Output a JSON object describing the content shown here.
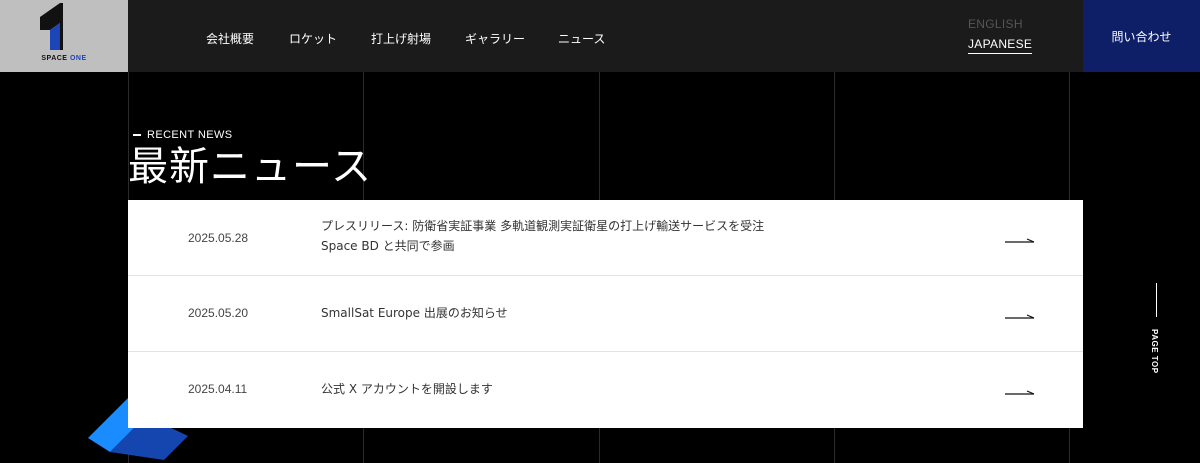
{
  "header": {
    "logo_text_a": "SPACE",
    "logo_text_b": "ONE",
    "nav": [
      {
        "label": "会社概要"
      },
      {
        "label": "ロケット"
      },
      {
        "label": "打上げ射場"
      },
      {
        "label": "ギャラリー"
      },
      {
        "label": "ニュース"
      }
    ],
    "lang_en": "ENGLISH",
    "lang_ja": "JAPANESE",
    "contact_label": "問い合わせ"
  },
  "section": {
    "subtitle": "RECENT NEWS",
    "title": "最新ニュース"
  },
  "news": [
    {
      "date": "2025.05.28",
      "title_line1": "プレスリリース: 防衛省実証事業 多軌道観測実証衛星の打上げ輸送サービスを受注",
      "title_line2": "Space BD と共同で参画"
    },
    {
      "date": "2025.05.20",
      "title_line1": "SmallSat Europe 出展のお知らせ",
      "title_line2": ""
    },
    {
      "date": "2025.04.11",
      "title_line1": "公式 X アカウントを開設します",
      "title_line2": ""
    }
  ],
  "page_top": "PAGE TOP",
  "colors": {
    "header_bg": "#1b1b1b",
    "contact_bg": "#0e1f68",
    "accent_blue": "#1a8cff"
  }
}
